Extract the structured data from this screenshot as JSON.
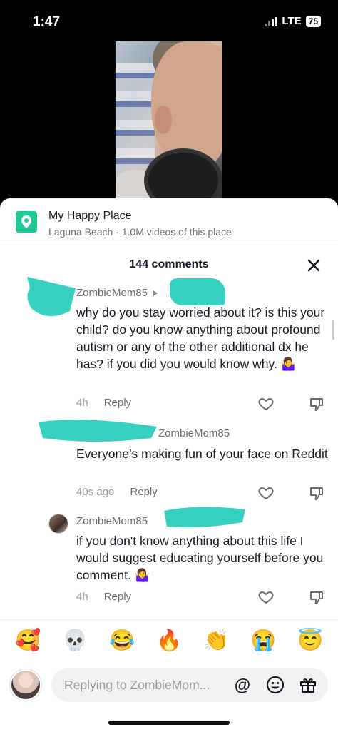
{
  "status_bar": {
    "time": "1:47",
    "network": "LTE",
    "battery": "75"
  },
  "place": {
    "title": "My Happy Place",
    "subtitle": "Laguna Beach · 1.0M videos of this place",
    "icon": "location-pin-icon"
  },
  "comments_header": {
    "count": "144 comments",
    "close_icon": "close-icon"
  },
  "comments": [
    {
      "user": "ZombieMom85",
      "text": "why do you stay worried about it? is this your child? do you know anything about profound autism or any of the other additional dx he has? if you did you would know why. 🤷‍♀️",
      "time": "4h",
      "reply": "Reply"
    },
    {
      "user": "ZombieMom85",
      "text": "Everyone’s making fun of your face on Reddit",
      "time": "40s ago",
      "reply": "Reply"
    },
    {
      "user": "ZombieMom85",
      "text": "if you don't know anything about this life I would suggest educating yourself before you comment. 🤷‍♀️",
      "time": "4h",
      "reply": "Reply"
    }
  ],
  "emoji_bar": [
    "🥰",
    "💀",
    "😂",
    "🔥",
    "👏",
    "😭",
    "😇"
  ],
  "reply_bar": {
    "placeholder": "Replying to ZombieMom...",
    "at_icon": "@",
    "emoji_icon": "☺",
    "gift_icon": "gift-icon"
  },
  "colors": {
    "redaction": "#35d0c0",
    "place_icon": "#20c997"
  }
}
